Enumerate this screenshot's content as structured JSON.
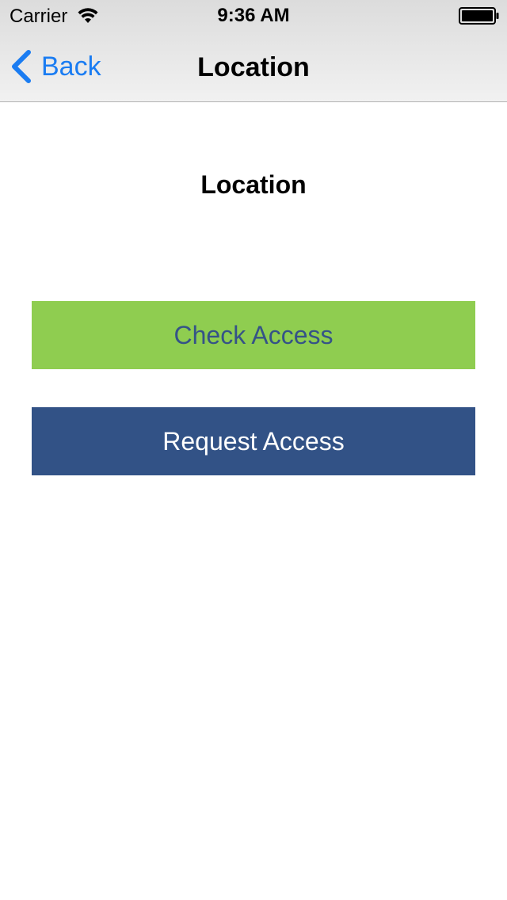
{
  "status_bar": {
    "carrier": "Carrier",
    "time": "9:36 AM",
    "wifi_icon": "wifi-icon",
    "battery_icon": "battery-full-icon"
  },
  "nav_bar": {
    "back_label": "Back",
    "back_icon": "chevron-left-icon",
    "title": "Location"
  },
  "content": {
    "heading": "Location",
    "check_access_label": "Check Access",
    "request_access_label": "Request Access"
  },
  "colors": {
    "tint": "#1a7cf2",
    "check_access_bg": "#8fcd50",
    "check_access_text": "#355387",
    "request_access_bg": "#325286",
    "request_access_text": "#ffffff"
  }
}
